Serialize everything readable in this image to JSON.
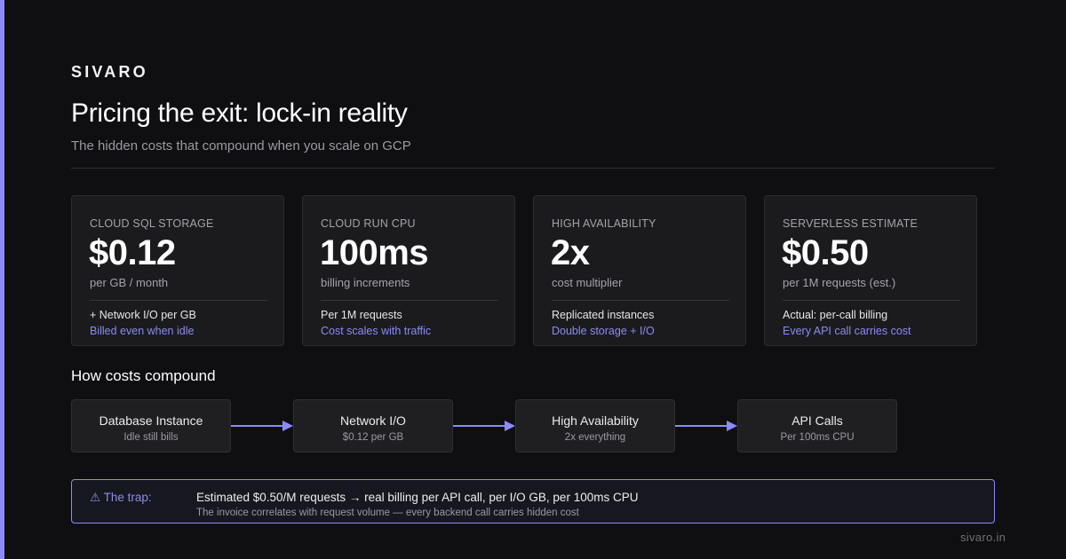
{
  "colors": {
    "accent": "#8b8cf6",
    "background": "#0f0f11",
    "card_bg": "#1b1b1e",
    "accent_text": "#8a8cf0"
  },
  "brand": "SIVARO",
  "title": "Pricing the exit: lock-in reality",
  "subtitle": "The hidden costs that compound when you scale on GCP",
  "cards": [
    {
      "label": "CLOUD SQL STORAGE",
      "value": "$0.12",
      "unit": "per GB / month",
      "note": "+ Network I/O per GB",
      "accent_note": "Billed even when idle"
    },
    {
      "label": "CLOUD RUN CPU",
      "value": "100ms",
      "unit": "billing increments",
      "note": "Per 1M requests",
      "accent_note": "Cost scales with traffic"
    },
    {
      "label": "HIGH AVAILABILITY",
      "value": "2x",
      "unit": "cost multiplier",
      "note": "Replicated instances",
      "accent_note": "Double storage + I/O"
    },
    {
      "label": "SERVERLESS ESTIMATE",
      "value": "$0.50",
      "unit": "per 1M requests (est.)",
      "note": "Actual: per-call billing",
      "accent_note": "Every API call carries cost"
    }
  ],
  "flow": {
    "title": "How costs compound",
    "steps": [
      {
        "name": "Database Instance",
        "sub": "Idle still bills"
      },
      {
        "name": "Network I/O",
        "sub": "$0.12 per GB"
      },
      {
        "name": "High Availability",
        "sub": "2x everything"
      },
      {
        "name": "API Calls",
        "sub": "Per 100ms CPU"
      }
    ],
    "arrow_icon": "arrow-right-icon"
  },
  "trap": {
    "icon": "warning-icon",
    "label": "⚠ The trap:",
    "main": "Estimated $0.50/M requests → real billing per API call, per I/O GB, per 100ms CPU",
    "sub": "The invoice correlates with request volume — every backend call carries hidden cost"
  },
  "footer": "sivaro.in"
}
